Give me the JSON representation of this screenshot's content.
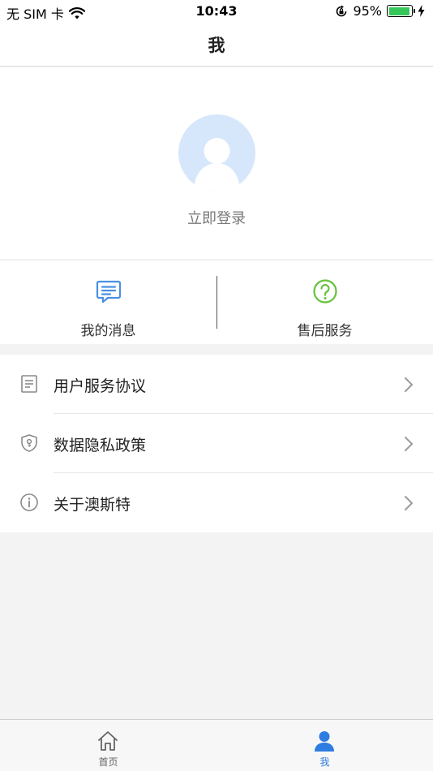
{
  "status_bar": {
    "carrier": "无 SIM 卡",
    "time": "10:43",
    "battery_percent": "95%",
    "battery_level": 0.95,
    "icons": [
      "wifi-icon",
      "orientation-lock-icon",
      "battery-icon",
      "charging-icon"
    ]
  },
  "nav": {
    "title": "我"
  },
  "profile": {
    "login_label": "立即登录",
    "avatar_icon": "avatar-placeholder-icon"
  },
  "quick_actions": [
    {
      "label": "我的消息",
      "icon": "message-icon",
      "color": "#4a90e2"
    },
    {
      "label": "售后服务",
      "icon": "help-circle-icon",
      "color": "#67c23a"
    }
  ],
  "menu": [
    {
      "label": "用户服务协议",
      "icon": "document-icon"
    },
    {
      "label": "数据隐私政策",
      "icon": "shield-lock-icon"
    },
    {
      "label": "关于澳斯特",
      "icon": "info-icon"
    }
  ],
  "tab_bar": {
    "tabs": [
      {
        "label": "首页",
        "icon": "home-icon",
        "active": false
      },
      {
        "label": "我",
        "icon": "user-icon",
        "active": true
      }
    ],
    "active_color": "#2f7de1",
    "inactive_color": "#666666"
  }
}
